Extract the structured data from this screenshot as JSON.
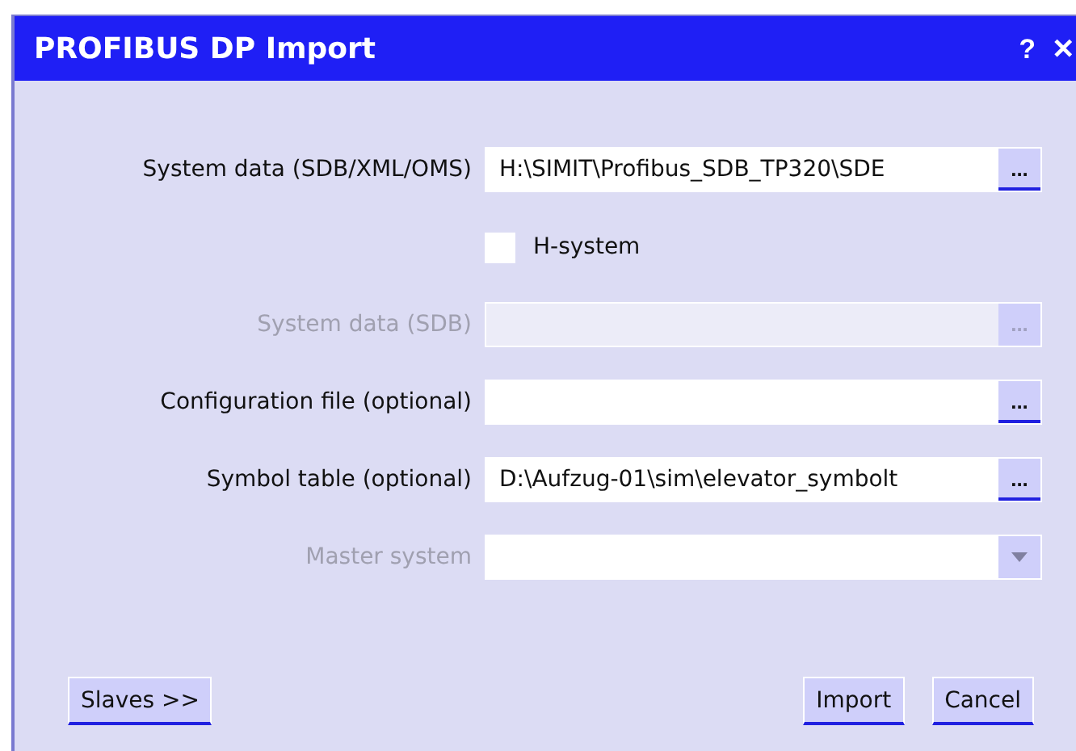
{
  "window": {
    "title": "PROFIBUS DP Import",
    "help": "?",
    "close": "✕"
  },
  "rows": [
    {
      "kind": "field",
      "label": "System data (SDB/XML/OMS)",
      "value": "H:\\SIMIT\\Profibus_SDB_TP320\\SDE",
      "browse": "...",
      "disabled": false
    },
    {
      "kind": "checkbox",
      "label": "H-system",
      "checked": false
    },
    {
      "kind": "field",
      "label": "System data (SDB)",
      "browse": "...",
      "disabled": true
    },
    {
      "kind": "field",
      "label": "Configuration file (optional)",
      "browse": "...",
      "disabled": false
    },
    {
      "kind": "field",
      "label": "Symbol table (optional)",
      "value": "D:\\Aufzug-01\\sim\\elevator_symbolt",
      "browse": "...",
      "disabled": false
    },
    {
      "kind": "dropdown",
      "label": "Master system",
      "disabled": true
    }
  ],
  "buttons": {
    "left": [
      "Slaves >>"
    ],
    "right": [
      "Import",
      "Cancel"
    ]
  }
}
